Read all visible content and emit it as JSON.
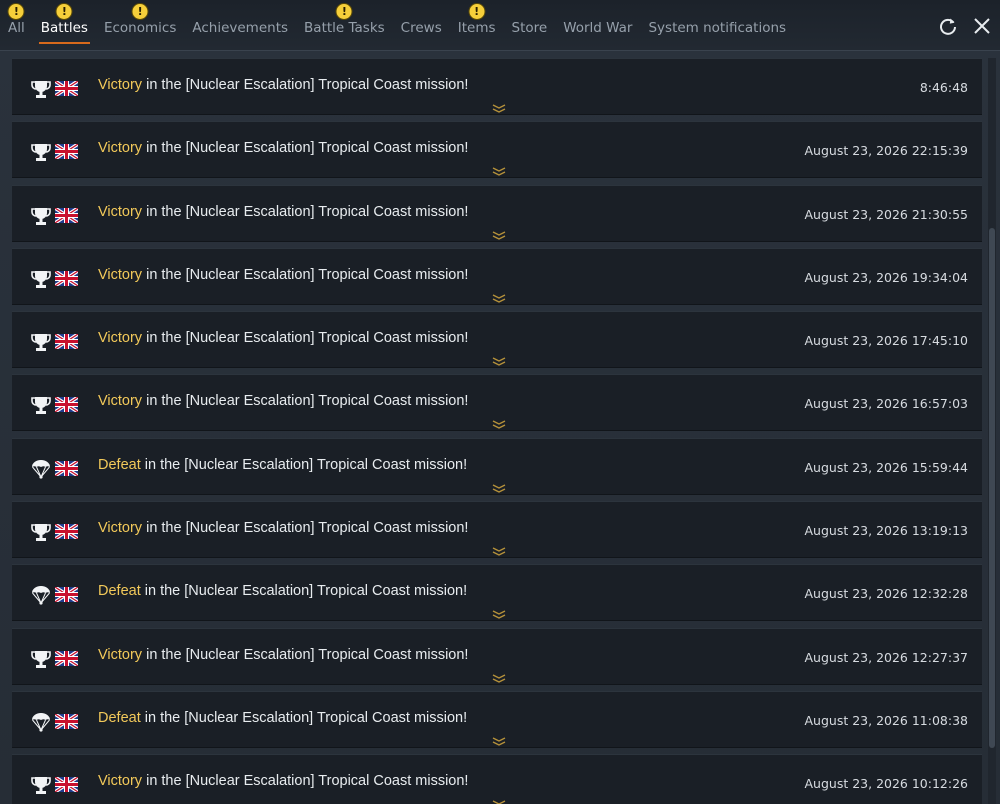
{
  "tabs": [
    {
      "label": "All",
      "alert": true,
      "active": false
    },
    {
      "label": "Battles",
      "alert": true,
      "active": true
    },
    {
      "label": "Economics",
      "alert": true,
      "active": false
    },
    {
      "label": "Achievements",
      "alert": false,
      "active": false
    },
    {
      "label": "Battle Tasks",
      "alert": true,
      "active": false
    },
    {
      "label": "Crews",
      "alert": false,
      "active": false
    },
    {
      "label": "Items",
      "alert": true,
      "active": false
    },
    {
      "label": "Store",
      "alert": false,
      "active": false
    },
    {
      "label": "World War",
      "alert": false,
      "active": false
    },
    {
      "label": "System notifications",
      "alert": false,
      "active": false
    }
  ],
  "alert_glyph": "!",
  "toolbar": {
    "refresh_icon": "refresh-icon",
    "close_icon": "close-icon"
  },
  "colors": {
    "accent": "#d86a1c",
    "result": "#f2c95a",
    "alert": "#f6cf3a"
  },
  "messages": [
    {
      "result": "Victory",
      "text": " in the [Nuclear Escalation] Tropical Coast mission!",
      "time": "8:46:48",
      "icon": "trophy-icon",
      "flag": "uk-flag-icon"
    },
    {
      "result": "Victory",
      "text": " in the [Nuclear Escalation] Tropical Coast mission!",
      "time": "August 23, 2026 22:15:39",
      "icon": "trophy-icon",
      "flag": "uk-flag-icon"
    },
    {
      "result": "Victory",
      "text": " in the [Nuclear Escalation] Tropical Coast mission!",
      "time": "August 23, 2026 21:30:55",
      "icon": "trophy-icon",
      "flag": "uk-flag-icon"
    },
    {
      "result": "Victory",
      "text": " in the [Nuclear Escalation] Tropical Coast mission!",
      "time": "August 23, 2026 19:34:04",
      "icon": "trophy-icon",
      "flag": "uk-flag-icon"
    },
    {
      "result": "Victory",
      "text": " in the [Nuclear Escalation] Tropical Coast mission!",
      "time": "August 23, 2026 17:45:10",
      "icon": "trophy-icon",
      "flag": "uk-flag-icon"
    },
    {
      "result": "Victory",
      "text": " in the [Nuclear Escalation] Tropical Coast mission!",
      "time": "August 23, 2026 16:57:03",
      "icon": "trophy-icon",
      "flag": "uk-flag-icon"
    },
    {
      "result": "Defeat",
      "text": " in the [Nuclear Escalation] Tropical Coast mission!",
      "time": "August 23, 2026 15:59:44",
      "icon": "parachute-icon",
      "flag": "uk-flag-icon"
    },
    {
      "result": "Victory",
      "text": " in the [Nuclear Escalation] Tropical Coast mission!",
      "time": "August 23, 2026 13:19:13",
      "icon": "trophy-icon",
      "flag": "uk-flag-icon"
    },
    {
      "result": "Defeat",
      "text": " in the [Nuclear Escalation] Tropical Coast mission!",
      "time": "August 23, 2026 12:32:28",
      "icon": "parachute-icon",
      "flag": "uk-flag-icon"
    },
    {
      "result": "Victory",
      "text": " in the [Nuclear Escalation] Tropical Coast mission!",
      "time": "August 23, 2026 12:27:37",
      "icon": "trophy-icon",
      "flag": "uk-flag-icon"
    },
    {
      "result": "Defeat",
      "text": " in the [Nuclear Escalation] Tropical Coast mission!",
      "time": "August 23, 2026 11:08:38",
      "icon": "parachute-icon",
      "flag": "uk-flag-icon"
    },
    {
      "result": "Victory",
      "text": " in the [Nuclear Escalation] Tropical Coast mission!",
      "time": "August 23, 2026 10:12:26",
      "icon": "trophy-icon",
      "flag": "uk-flag-icon"
    }
  ]
}
